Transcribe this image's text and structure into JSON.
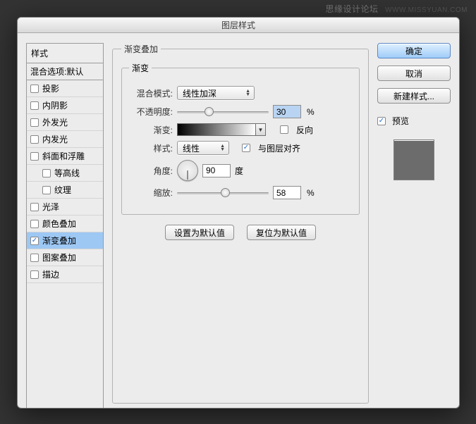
{
  "watermark": {
    "text1": "思缘设计论坛",
    "text2": "WWW.MISSYUAN.COM"
  },
  "window": {
    "title": "图层样式"
  },
  "styles": {
    "header": "样式",
    "blending_options": "混合选项:默认",
    "items": [
      {
        "label": "投影",
        "checked": false
      },
      {
        "label": "内阴影",
        "checked": false
      },
      {
        "label": "外发光",
        "checked": false
      },
      {
        "label": "内发光",
        "checked": false
      },
      {
        "label": "斜面和浮雕",
        "checked": false
      },
      {
        "label": "等高线",
        "checked": false,
        "sub": true
      },
      {
        "label": "纹理",
        "checked": false,
        "sub": true
      },
      {
        "label": "光泽",
        "checked": false
      },
      {
        "label": "颜色叠加",
        "checked": false
      },
      {
        "label": "渐变叠加",
        "checked": true,
        "selected": true
      },
      {
        "label": "图案叠加",
        "checked": false
      },
      {
        "label": "描边",
        "checked": false
      }
    ]
  },
  "group": {
    "title": "渐变叠加",
    "inner_title": "渐变",
    "blend_mode_label": "混合模式:",
    "blend_mode_value": "线性加深",
    "opacity_label": "不透明度:",
    "opacity_value": "30",
    "opacity_pct": "%",
    "gradient_label": "渐变:",
    "reverse_label": "反向",
    "style_label": "样式:",
    "style_value": "线性",
    "align_label": "与图层对齐",
    "angle_label": "角度:",
    "angle_value": "90",
    "angle_unit": "度",
    "scale_label": "缩放:",
    "scale_value": "58",
    "scale_pct": "%",
    "btn_set_default": "设置为默认值",
    "btn_reset_default": "复位为默认值"
  },
  "right": {
    "ok": "确定",
    "cancel": "取消",
    "new_style": "新建样式...",
    "preview_label": "预览"
  }
}
